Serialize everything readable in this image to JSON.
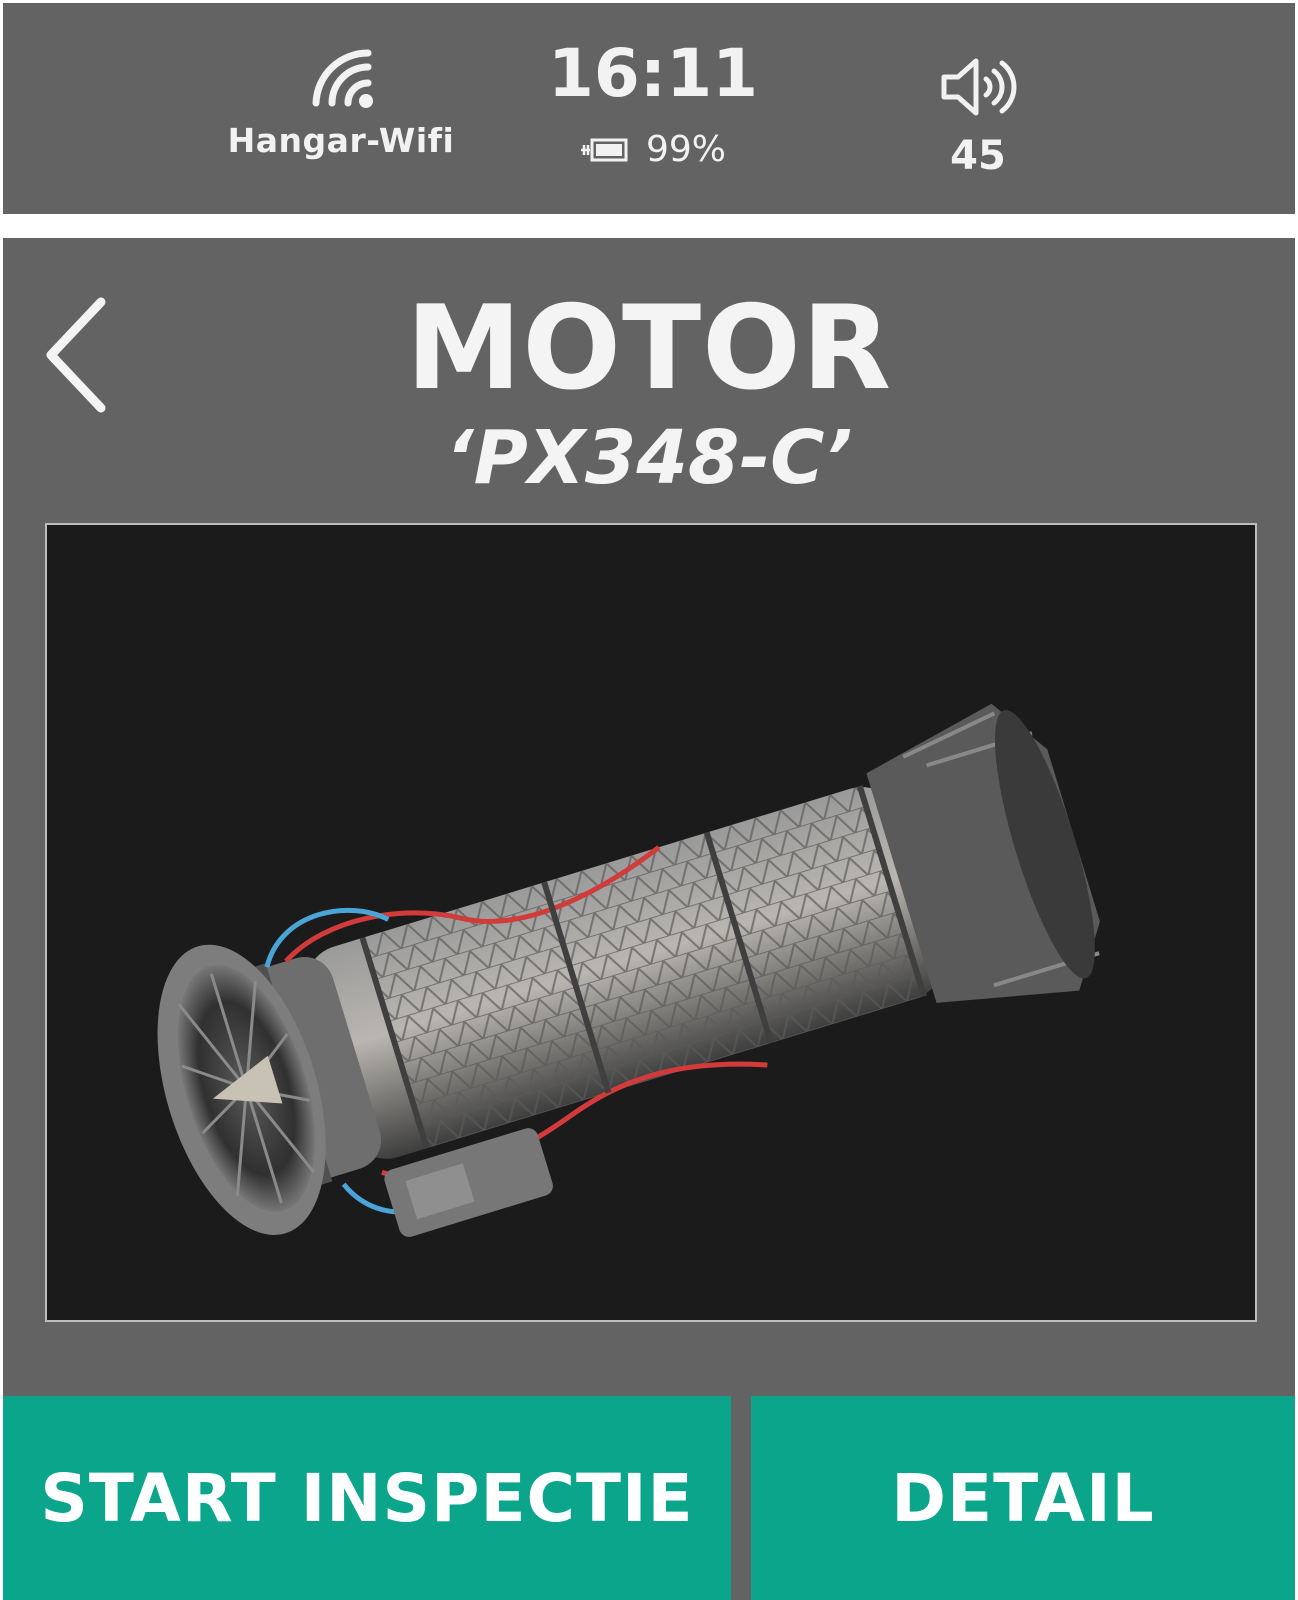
{
  "status_bar": {
    "wifi": {
      "icon": "wifi-icon",
      "label": "Hangar-Wifi"
    },
    "time": "16:11",
    "battery": {
      "icon": "battery-icon",
      "level": "99%"
    },
    "volume": {
      "icon": "speaker-icon",
      "value": "45"
    }
  },
  "header": {
    "back_icon": "chevron-left-icon",
    "title": "MOTOR",
    "subtitle": "‘PX348-C’"
  },
  "image": {
    "content": "jet engine render"
  },
  "actions": {
    "start_label": "START INSPECTIE",
    "detail_label": "DETAIL"
  },
  "colors": {
    "panel": "#636363",
    "accent": "#0aa58b",
    "image_bg": "#1b1b1b",
    "text": "#f4f4f4"
  }
}
